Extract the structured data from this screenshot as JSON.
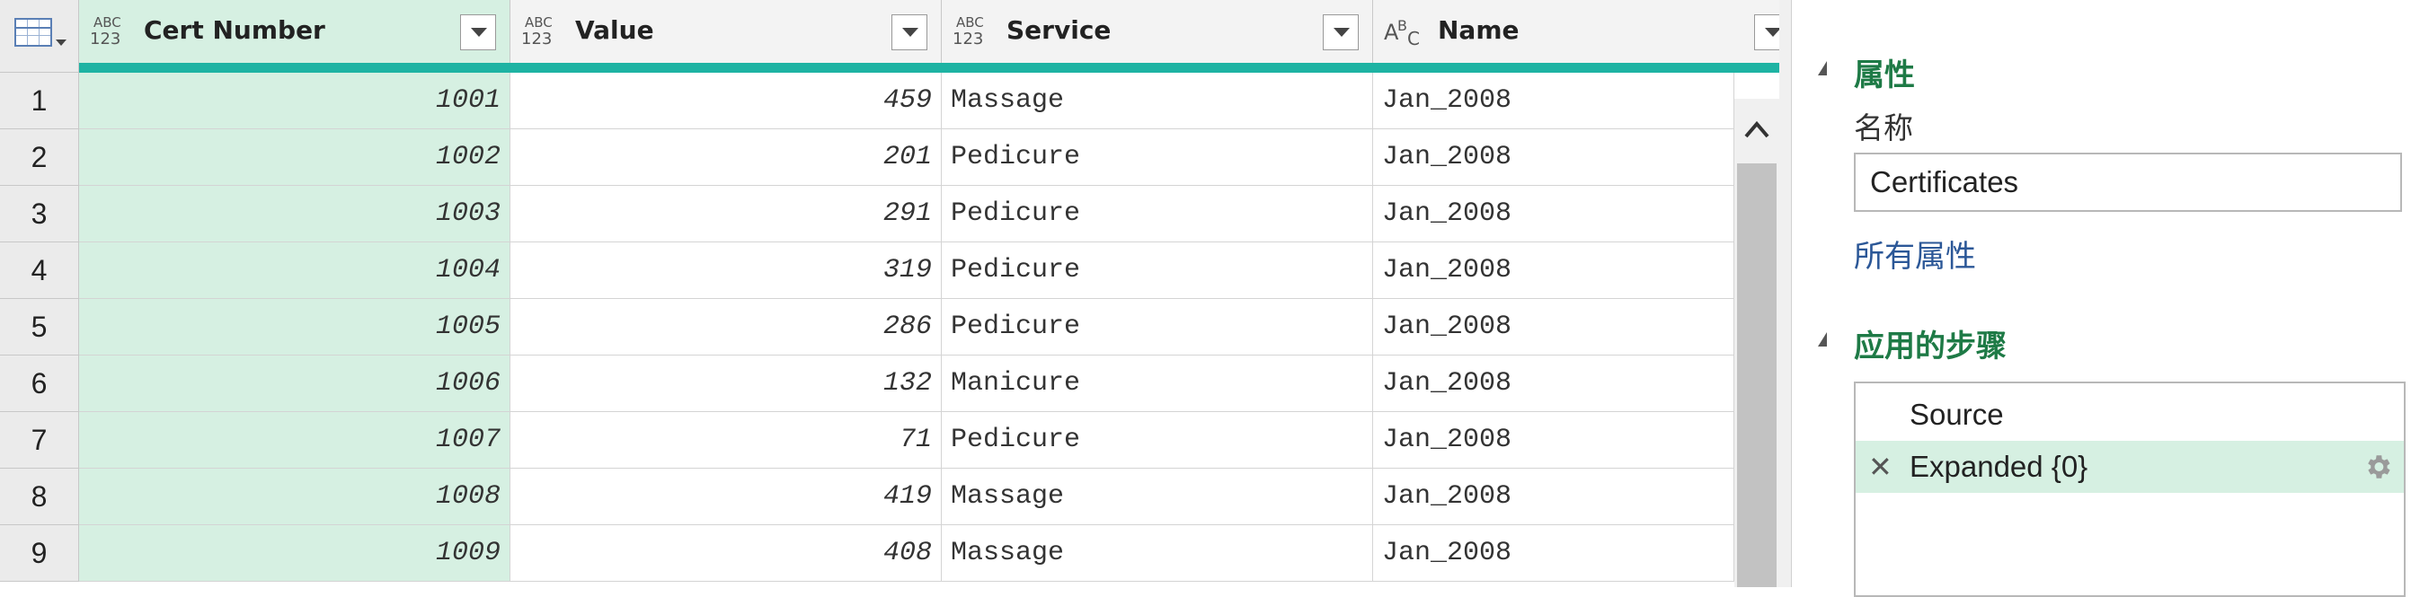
{
  "grid": {
    "columns": [
      {
        "name": "Cert Number",
        "type": "ABC123",
        "selected": true
      },
      {
        "name": "Value",
        "type": "ABC123",
        "selected": false
      },
      {
        "name": "Service",
        "type": "ABC123",
        "selected": false
      },
      {
        "name": "Name",
        "type": "ABC",
        "selected": false
      }
    ],
    "type_icon_top": "ABC",
    "type_icon_bottom": "123",
    "rows": [
      {
        "n": "1",
        "cert": "1001",
        "value": "459",
        "service": "Massage",
        "name": "Jan_2008"
      },
      {
        "n": "2",
        "cert": "1002",
        "value": "201",
        "service": "Pedicure",
        "name": "Jan_2008"
      },
      {
        "n": "3",
        "cert": "1003",
        "value": "291",
        "service": "Pedicure",
        "name": "Jan_2008"
      },
      {
        "n": "4",
        "cert": "1004",
        "value": "319",
        "service": "Pedicure",
        "name": "Jan_2008"
      },
      {
        "n": "5",
        "cert": "1005",
        "value": "286",
        "service": "Pedicure",
        "name": "Jan_2008"
      },
      {
        "n": "6",
        "cert": "1006",
        "value": "132",
        "service": "Manicure",
        "name": "Jan_2008"
      },
      {
        "n": "7",
        "cert": "1007",
        "value": "71",
        "service": "Pedicure",
        "name": "Jan_2008"
      },
      {
        "n": "8",
        "cert": "1008",
        "value": "419",
        "service": "Massage",
        "name": "Jan_2008"
      },
      {
        "n": "9",
        "cert": "1009",
        "value": "408",
        "service": "Massage",
        "name": "Jan_2008"
      }
    ]
  },
  "pane": {
    "properties_title": "属性",
    "name_label": "名称",
    "name_value": "Certificates",
    "all_properties_link": "所有属性",
    "steps_title": "应用的步骤",
    "steps": [
      {
        "label": "Source",
        "active": false,
        "deletable": false,
        "has_settings": false
      },
      {
        "label": "Expanded {0}",
        "active": true,
        "deletable": true,
        "has_settings": true
      }
    ],
    "icons": {
      "delete": "x-icon",
      "settings": "gear-icon",
      "collapse": "collapse-triangle-icon"
    }
  },
  "colors": {
    "accent_green": "#1e7a46",
    "selected_bg": "#d6f0e2",
    "quality_bar": "#1eb3a3",
    "link_blue": "#2b5797"
  }
}
